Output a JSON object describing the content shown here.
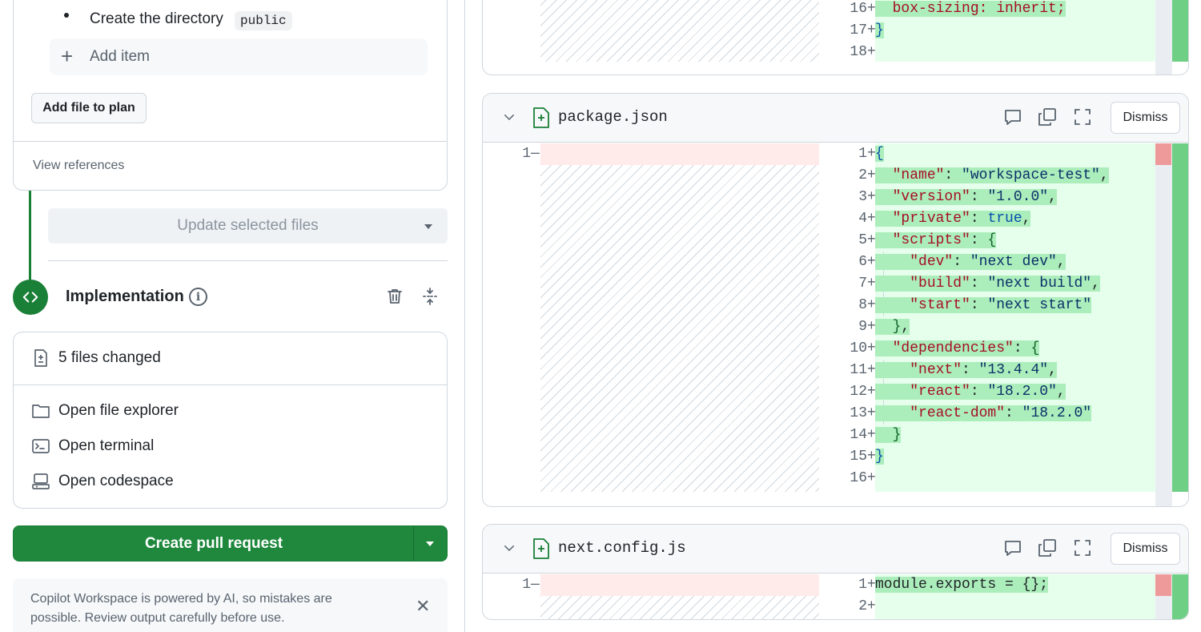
{
  "plan": {
    "bullet_text": "Create the directory",
    "bullet_code": "public",
    "add_item_label": "Add item",
    "add_file_label": "Add file to plan",
    "view_references": "View references"
  },
  "update": {
    "label": "Update selected files"
  },
  "implementation": {
    "title": "Implementation",
    "files_changed": "5 files changed",
    "actions": [
      "Open file explorer",
      "Open terminal",
      "Open codespace"
    ]
  },
  "create_pr": {
    "label": "Create pull request"
  },
  "notice": {
    "text": "Copilot Workspace is powered by AI, so mistakes are possible. Review output carefully before use."
  },
  "top_diff": {
    "lines": [
      {
        "num": "16",
        "sign": "+",
        "code": "  box-sizing: inherit;"
      },
      {
        "num": "17",
        "sign": "+",
        "code": "}"
      },
      {
        "num": "18",
        "sign": "+",
        "code": ""
      }
    ]
  },
  "package_json": {
    "filename": "package.json",
    "dismiss": "Dismiss",
    "old_lines": [
      {
        "num": "1",
        "sign": "—"
      }
    ],
    "new_lines": [
      {
        "num": "1",
        "sign": "+"
      },
      {
        "num": "2",
        "sign": "+"
      },
      {
        "num": "3",
        "sign": "+"
      },
      {
        "num": "4",
        "sign": "+"
      },
      {
        "num": "5",
        "sign": "+"
      },
      {
        "num": "6",
        "sign": "+"
      },
      {
        "num": "7",
        "sign": "+"
      },
      {
        "num": "8",
        "sign": "+"
      },
      {
        "num": "9",
        "sign": "+"
      },
      {
        "num": "10",
        "sign": "+"
      },
      {
        "num": "11",
        "sign": "+"
      },
      {
        "num": "12",
        "sign": "+"
      },
      {
        "num": "13",
        "sign": "+"
      },
      {
        "num": "14",
        "sign": "+"
      },
      {
        "num": "15",
        "sign": "+"
      },
      {
        "num": "16",
        "sign": "+"
      }
    ],
    "code": {
      "l1": "{",
      "name_key": "\"name\"",
      "name_val": "\"workspace-test\"",
      "version_key": "\"version\"",
      "version_val": "\"1.0.0\"",
      "private_key": "\"private\"",
      "private_val": "true",
      "scripts_key": "\"scripts\"",
      "dev_key": "\"dev\"",
      "dev_val": "\"next dev\"",
      "build_key": "\"build\"",
      "build_val": "\"next build\"",
      "start_key": "\"start\"",
      "start_val": "\"next start\"",
      "deps_key": "\"dependencies\"",
      "next_key": "\"next\"",
      "next_val": "\"13.4.4\"",
      "react_key": "\"react\"",
      "react_val": "\"18.2.0\"",
      "reactdom_key": "\"react-dom\"",
      "reactdom_val": "\"18.2.0\""
    }
  },
  "next_config": {
    "filename": "next.config.js",
    "dismiss": "Dismiss",
    "old_lines": [
      {
        "num": "1",
        "sign": "—"
      }
    ],
    "new_lines": [
      {
        "num": "1",
        "sign": "+"
      },
      {
        "num": "2",
        "sign": "+"
      }
    ],
    "code_l1": "module.exports = {};"
  },
  "colors": {
    "accent_green": "#1f883d",
    "added_bg": "#e6ffec",
    "added_highlight": "#aceebb",
    "deleted_bg": "#ffebe9"
  }
}
